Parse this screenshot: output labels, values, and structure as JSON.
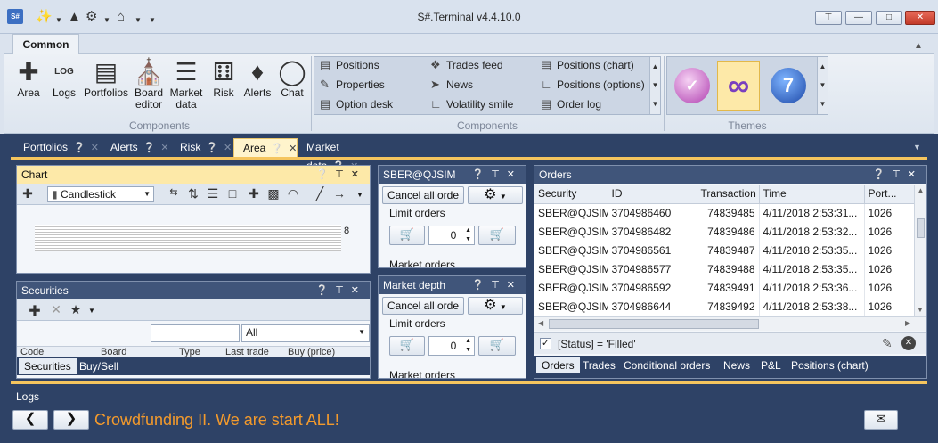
{
  "window": {
    "title": "S#.Terminal v4.4.10.0",
    "logo": "S#"
  },
  "quick_access": [
    "plug-icon",
    "warning-icon",
    "gear-icon",
    "home-icon"
  ],
  "ribbon": {
    "tab": "Common",
    "buttons": [
      {
        "label": "Area",
        "icon": "plus-icon"
      },
      {
        "label": "Logs",
        "icon": "log-icon"
      },
      {
        "label": "Portfolios",
        "icon": "briefcase-icon"
      },
      {
        "label": "Board editor",
        "icon": "bank-icon"
      },
      {
        "label": "Market data",
        "icon": "database-icon"
      },
      {
        "label": "Risk",
        "icon": "dice-icon"
      },
      {
        "label": "Alerts",
        "icon": "bell-icon"
      },
      {
        "label": "Chat",
        "icon": "chat-icon"
      }
    ],
    "group1_label": "Components",
    "gallery": [
      [
        "Positions",
        "Trades feed",
        "Positions (chart)"
      ],
      [
        "Properties",
        "News",
        "Positions (options)"
      ],
      [
        "Option desk",
        "Volatility smile",
        "Order log"
      ]
    ],
    "group2_label": "Components",
    "group3_label": "Themes"
  },
  "doc_tabs": [
    "Portfolios",
    "Alerts",
    "Risk",
    "Area",
    "Market data"
  ],
  "chart_panel": {
    "title": "Chart",
    "style": "Candlestick",
    "axis_label": "8"
  },
  "securities_panel": {
    "title": "Securities",
    "filter_value": "All",
    "columns": [
      "Code",
      "Board",
      "Type",
      "Last trade",
      "Buy (price)"
    ],
    "bottom_tabs": [
      "Securities",
      "Buy/Sell"
    ]
  },
  "sber_panel": {
    "title": "SBER@QJSIM",
    "cancel_label": "Cancel all orde",
    "limit_label": "Limit orders",
    "qty": "0",
    "market_label": "Market orders"
  },
  "depth_panel": {
    "title": "Market depth",
    "cancel_label": "Cancel all orde",
    "limit_label": "Limit orders",
    "qty": "0",
    "market_label": "Market orders"
  },
  "orders_panel": {
    "title": "Orders",
    "columns": [
      "Security",
      "ID",
      "Transaction",
      "Time",
      "Port..."
    ],
    "rows": [
      [
        "SBER@QJSIM",
        "3704986460",
        "74839485",
        "4/11/2018 2:53:31...",
        "1026"
      ],
      [
        "SBER@QJSIM",
        "3704986482",
        "74839486",
        "4/11/2018 2:53:32...",
        "1026"
      ],
      [
        "SBER@QJSIM",
        "3704986561",
        "74839487",
        "4/11/2018 2:53:35...",
        "1026"
      ],
      [
        "SBER@QJSIM",
        "3704986577",
        "74839488",
        "4/11/2018 2:53:35...",
        "1026"
      ],
      [
        "SBER@QJSIM",
        "3704986592",
        "74839491",
        "4/11/2018 2:53:36...",
        "1026"
      ],
      [
        "SBER@QJSIM",
        "3704986644",
        "74839492",
        "4/11/2018 2:53:38...",
        "1026"
      ]
    ],
    "filter_text": "[Status] = 'Filled'",
    "bottom_tabs": [
      "Orders",
      "Trades",
      "Conditional orders",
      "News",
      "P&L",
      "Positions (chart)"
    ]
  },
  "logs": {
    "title": "Logs",
    "message": "Crowdfunding II. We are start ALL!"
  },
  "colors": {
    "accent": "#f5c55e",
    "dark": "#2e4266",
    "message": "#f39a2c"
  }
}
